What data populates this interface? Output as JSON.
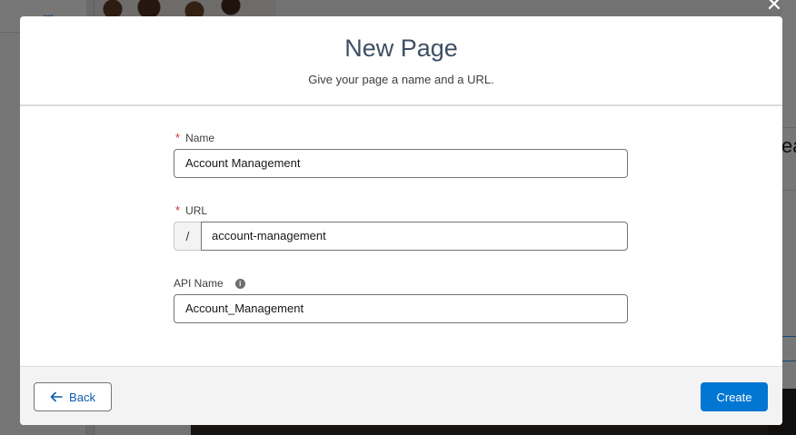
{
  "modal": {
    "title": "New Page",
    "subtitle": "Give your page a name and a URL."
  },
  "fields": {
    "name": {
      "label": "Name",
      "required_mark": "*",
      "value": "Account Management"
    },
    "url": {
      "label": "URL",
      "required_mark": "*",
      "prefix": "/",
      "value": "account-management"
    },
    "api_name": {
      "label": "API Name",
      "info_icon": "i",
      "value": "Account_Management"
    }
  },
  "footer": {
    "back_label": "Back",
    "create_label": "Create"
  },
  "background": {
    "partial_text": "ea"
  },
  "icons": {
    "close": "close-icon",
    "back_arrow": "arrow-left-icon",
    "info": "info-icon"
  },
  "colors": {
    "primary": "#0176d3",
    "link": "#0b5cab",
    "required": "#c23934",
    "title": "#3e4f63"
  }
}
